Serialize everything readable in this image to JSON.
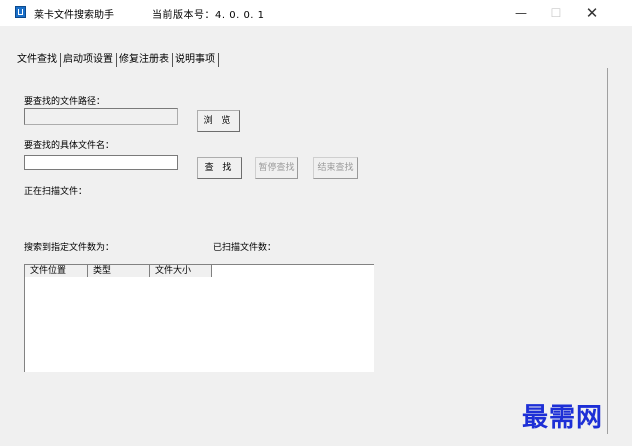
{
  "window": {
    "title": "莱卡文件搜索助手",
    "version": "当前版本号：4. 0. 0. 1",
    "controls": {
      "minimize": "—",
      "maximize": "☐",
      "close": "✕"
    }
  },
  "tabs": [
    "文件查找",
    "启动项设置",
    "修复注册表",
    "说明事项"
  ],
  "search": {
    "path_label": "要查找的文件路径：",
    "path_value": "",
    "browse_label": "浏 览",
    "name_label": "要查找的具体文件名：",
    "name_value": "",
    "find_label": "查 找",
    "pause_label": "暂停查找",
    "stop_label": "结束查找",
    "scanning_label": "正在扫描文件：",
    "found_label": "搜索到指定文件数为：",
    "scanned_label": "已扫描文件数："
  },
  "results": {
    "columns": [
      "文件位置",
      "类型",
      "文件大小"
    ]
  },
  "watermark": "最需网",
  "colors": {
    "watermark": "#1d2fd6",
    "icon": "#1a6fc9"
  },
  "icons": {
    "app": "app-icon"
  }
}
